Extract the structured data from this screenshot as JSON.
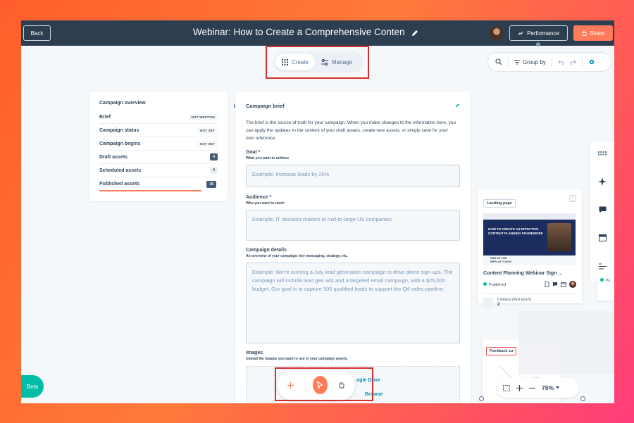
{
  "header": {
    "back_label": "Back",
    "title": "Webinar: How to Create a Comprehensive Conten",
    "performance_label": "Performance",
    "share_label": "Share"
  },
  "mode_toggle": {
    "create_label": "Create",
    "manage_label": "Manage"
  },
  "canvas_toolbar": {
    "group_by_label": "Group by"
  },
  "overview": {
    "title": "Campaign overview",
    "rows": [
      {
        "label": "Brief",
        "value": "NOT WRITTEN"
      },
      {
        "label": "Campaign status",
        "value": "NOT SET"
      },
      {
        "label": "Campaign begins",
        "value": "NOT SET"
      },
      {
        "label": "Draft assets",
        "value": "4"
      },
      {
        "label": "Scheduled assets",
        "value": "0"
      },
      {
        "label": "Published assets",
        "value": "16"
      }
    ]
  },
  "brief": {
    "title": "Campaign brief",
    "description": "The brief is the source of truth for your campaign. When you make changes to the information here, you can apply the updates to the content of your draft assets, create new assets, or simply save for your own reference.",
    "goal": {
      "label": "Goal *",
      "help": "What you want to achieve",
      "placeholder": "Example: Increase leads by 20%"
    },
    "audience": {
      "label": "Audience *",
      "help": "Who you want to reach",
      "placeholder": "Example: IT decision-makers at mid-to-large US companies"
    },
    "details": {
      "label": "Campaign details",
      "help": "An overview of your campaign: key messaging, strategy, etc.",
      "placeholder": "Example: We're running a July lead generation campaign to drive demo sign-ups. The campaign will include lead gen ads and a targeted email campaign, with a $25,000 budget. Our goal is to capture 500 qualified leads to support the Q4 sales pipeline."
    },
    "images": {
      "label": "Images",
      "help": "Upload the images you want to use in your campaign assets.",
      "google_drive_label": "ogle Drive",
      "browse_label": "Browse"
    }
  },
  "beta_label": "Beta",
  "asset_card": {
    "tag": "Landing page",
    "thumb_title": "HOW TO CREATE AN EFFECTIVE CONTENT PLANNING FRAMEWORK",
    "thumb_cta": "WATCH THE REPLAY TODAY",
    "name": "Content Planning Webinar Sign ...",
    "status": "Published",
    "metric_label": "Contacts (First touch)",
    "metric_value": "2"
  },
  "feedback_card": {
    "tag": "Feedback su"
  },
  "side_card": {
    "status": "Pu"
  },
  "zoom": {
    "value": "75%"
  },
  "colors": {
    "accent": "#ff7a59",
    "header_bg": "#2d3e50",
    "highlight_box": "#d72d2d",
    "published": "#00bda5",
    "beta": "#00bda5"
  }
}
